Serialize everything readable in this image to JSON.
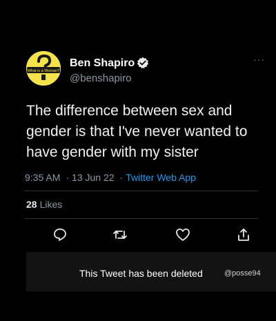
{
  "tweet": {
    "avatar_text": "What is a Woman?",
    "display_name": "Ben Shapiro",
    "handle": "@benshapiro",
    "text": "The difference between sex and gender is that I've never wanted to have gender with my sister",
    "time": "9:35 AM",
    "date": "13 Jun 22",
    "source": "Twitter Web App",
    "likes_count": "28",
    "likes_label": "Likes",
    "verified_icon": "verified-badge-icon"
  },
  "actions": [
    {
      "name": "reply",
      "icon": "speech-bubble-icon"
    },
    {
      "name": "retweet",
      "icon": "retweet-icon"
    },
    {
      "name": "like",
      "icon": "heart-icon"
    },
    {
      "name": "share",
      "icon": "share-icon"
    }
  ],
  "banner": {
    "deleted_text": "This Tweet has been deleted",
    "watermark": "@posse94"
  },
  "colors": {
    "background": "#000000",
    "link": "#1d9bf0",
    "muted": "#8b98a5",
    "avatar_yellow": "#f6e24a"
  }
}
